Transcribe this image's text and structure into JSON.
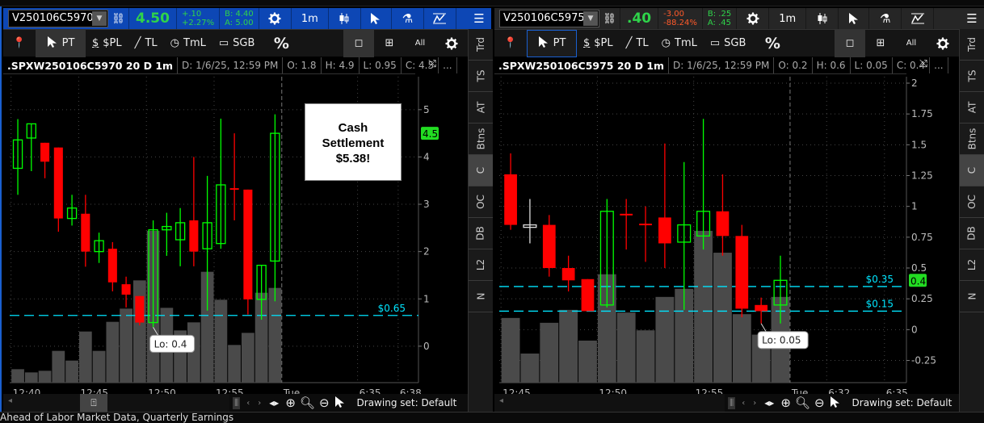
{
  "news_headline": "Ahead of Labor Market Data, Quarterly Earnings",
  "colors": {
    "up": "#00ff00",
    "down": "#ff0000",
    "flat": "#dddddd",
    "volume": "#4a4a4a",
    "price_line": "#00e5ff",
    "active_header": "#0d47b5"
  },
  "panels": [
    {
      "symbol": "V250106C5970",
      "last": "4.50",
      "change": "+.10",
      "change_pct": "+2.27%",
      "change_color": "#2fd34a",
      "bid": "B: 4.40",
      "ask": "A: 5.00",
      "interval": "1m",
      "toolbar": {
        "pt": "PT",
        "pl": "$PL",
        "tl": "TL",
        "tml": "TmL",
        "sgb": "SGB",
        "pct": "%",
        "all": "All"
      },
      "info": {
        "title": ".SPXW250106C5970 20 D 1m",
        "date": "D: 1/6/25, 12:59 PM",
        "open": "O: 1.8",
        "high": "H: 4.9",
        "low": "L: 0.95",
        "close": "C: 4.5",
        "more": "..."
      },
      "tabs": [
        "Trd",
        "TS",
        "AT",
        "Btns",
        "C",
        "OC",
        "DB",
        "L2",
        "N"
      ],
      "selected_tab": "C",
      "drawing_set": "Drawing set: Default",
      "annotation": {
        "line1": "Cash",
        "line2": "Settlement",
        "line3": "$5.38!"
      },
      "chart_data": {
        "type": "candlestick",
        "ylim": [
          -0.77,
          5.56
        ],
        "xlim_bars": [
          -0.6,
          29.6
        ],
        "y_ticks": [
          0,
          1,
          2,
          3,
          4,
          5
        ],
        "y_tick_labels": [
          "0",
          "1",
          "2",
          "3",
          "4",
          "5"
        ],
        "x_ticks": [
          {
            "at": -0.5,
            "label": "12:40"
          },
          {
            "at": 4.5,
            "label": "12:45"
          },
          {
            "at": 9.5,
            "label": "12:50"
          },
          {
            "at": 14.5,
            "label": "12:55"
          },
          {
            "at": 19.5,
            "label": "Tue"
          },
          {
            "at": 25.1,
            "label": "6:35"
          },
          {
            "at": 28.1,
            "label": "6:38"
          }
        ],
        "session_break_at": 19.5,
        "candles": [
          {
            "o": 3.76,
            "h": 4.8,
            "l": 3.2,
            "c": 4.36
          },
          {
            "o": 4.4,
            "h": 4.7,
            "l": 3.7,
            "c": 4.7
          },
          {
            "o": 4.3,
            "h": 4.3,
            "l": 3.55,
            "c": 3.9
          },
          {
            "o": 4.2,
            "h": 4.2,
            "l": 2.42,
            "c": 2.7
          },
          {
            "o": 2.7,
            "h": 3.2,
            "l": 2.55,
            "c": 2.92
          },
          {
            "o": 2.8,
            "h": 3.2,
            "l": 1.68,
            "c": 2.0
          },
          {
            "o": 2.0,
            "h": 2.4,
            "l": 1.76,
            "c": 2.23
          },
          {
            "o": 2.06,
            "h": 2.2,
            "l": 1.16,
            "c": 1.35
          },
          {
            "o": 1.31,
            "h": 1.47,
            "l": 0.82,
            "c": 1.09
          },
          {
            "o": 1.06,
            "h": 1.06,
            "l": 0.44,
            "c": 0.5
          },
          {
            "o": 0.5,
            "h": 2.66,
            "l": 0.4,
            "c": 2.46
          },
          {
            "o": 2.46,
            "h": 2.82,
            "l": 1.91,
            "c": 2.53
          },
          {
            "o": 2.25,
            "h": 2.92,
            "l": 1.69,
            "c": 2.61
          },
          {
            "o": 2.66,
            "h": 4.0,
            "l": 1.69,
            "c": 2.0
          },
          {
            "o": 2.06,
            "h": 3.6,
            "l": 0.75,
            "c": 2.61
          },
          {
            "o": 2.17,
            "h": 4.81,
            "l": 2.06,
            "c": 3.41
          },
          {
            "o": 3.34,
            "h": 4.5,
            "l": 2.66,
            "c": 3.31
          },
          {
            "o": 3.31,
            "h": 3.31,
            "l": 0.67,
            "c": 0.99
          },
          {
            "o": 0.99,
            "h": 1.71,
            "l": 0.56,
            "c": 1.71
          },
          {
            "o": 1.8,
            "h": 4.9,
            "l": 0.95,
            "c": 4.5
          }
        ],
        "volume": [
          50,
          38,
          44,
          118,
          82,
          190,
          118,
          226,
          275,
          380,
          564,
          278,
          194,
          224,
          412,
          308,
          140,
          185,
          334,
          352
        ],
        "price_lines": [
          {
            "value": 0.65,
            "label": "$0.65"
          }
        ],
        "current_price": {
          "value": 4.5,
          "label": "4.5"
        },
        "low_marker": {
          "bar": 10,
          "value": 0.4,
          "label": "Lo: 0.4"
        }
      }
    },
    {
      "symbol": "V250106C5975",
      "last": ".40",
      "change": "-3.00",
      "change_pct": "-88.24%",
      "change_color": "#ff5a2a",
      "bid": "B: .25",
      "ask": "A: .45",
      "interval": "1m",
      "toolbar": {
        "pt": "PT",
        "pl": "$PL",
        "tl": "TL",
        "tml": "TmL",
        "sgb": "SGB",
        "pct": "%",
        "all": "All"
      },
      "info": {
        "title": ".SPXW250106C5975 20 D 1m",
        "date": "D: 1/6/25, 12:59 PM",
        "open": "O: 0.2",
        "high": "H: 0.6",
        "low": "L: 0.05",
        "close": "C: 0.4",
        "more": "..."
      },
      "tabs": [
        "Trd",
        "TS",
        "AT",
        "Btns",
        "C",
        "OC",
        "DB",
        "L2",
        "N"
      ],
      "selected_tab": "C",
      "drawing_set": "Drawing set: Default",
      "chart_data": {
        "type": "candlestick",
        "ylim": [
          -0.43,
          2.0
        ],
        "xlim_bars": [
          -0.59,
          20.54
        ],
        "y_ticks": [
          -0.25,
          0,
          0.25,
          0.5,
          0.75,
          1,
          1.25,
          1.5,
          1.75,
          2
        ],
        "y_tick_labels": [
          "-0.25",
          "0",
          "0.25",
          "0.5",
          "0.75",
          "1",
          "1.25",
          "1.5",
          "1.75",
          "2"
        ],
        "x_ticks": [
          {
            "at": -0.5,
            "label": "12:45"
          },
          {
            "at": 4.5,
            "label": "12:50"
          },
          {
            "at": 9.5,
            "label": "12:55"
          },
          {
            "at": 14.5,
            "label": "Tue"
          },
          {
            "at": 16.4,
            "label": "6:32"
          },
          {
            "at": 19.4,
            "label": "6:35"
          }
        ],
        "session_break_at": 14.5,
        "candles": [
          {
            "o": 1.26,
            "h": 1.43,
            "l": 0.81,
            "c": 0.85
          },
          {
            "o": 0.85,
            "h": 1.06,
            "l": 0.7,
            "c": 0.83,
            "flat": true
          },
          {
            "o": 0.85,
            "h": 0.93,
            "l": 0.43,
            "c": 0.5
          },
          {
            "o": 0.5,
            "h": 0.6,
            "l": 0.31,
            "c": 0.4
          },
          {
            "o": 0.41,
            "h": 0.41,
            "l": 0.15,
            "c": 0.15
          },
          {
            "o": 0.2,
            "h": 1.06,
            "l": 0.18,
            "c": 0.96
          },
          {
            "o": 0.94,
            "h": 1.06,
            "l": 0.65,
            "c": 0.93
          },
          {
            "o": 0.86,
            "h": 1.0,
            "l": 0.55,
            "c": 0.85
          },
          {
            "o": 0.91,
            "h": 1.51,
            "l": 0.5,
            "c": 0.7
          },
          {
            "o": 0.71,
            "h": 1.36,
            "l": 0.16,
            "c": 0.85
          },
          {
            "o": 0.76,
            "h": 1.71,
            "l": 0.65,
            "c": 0.96
          },
          {
            "o": 0.96,
            "h": 1.26,
            "l": 0.6,
            "c": 0.76
          },
          {
            "o": 0.76,
            "h": 0.85,
            "l": 0.1,
            "c": 0.17
          },
          {
            "o": 0.2,
            "h": 0.26,
            "l": 0.05,
            "c": 0.15
          },
          {
            "o": 0.2,
            "h": 0.6,
            "l": 0.05,
            "c": 0.4
          }
        ],
        "volume": [
          240,
          108,
          222,
          270,
          156,
          402,
          260,
          194,
          318,
          348,
          563,
          482,
          254,
          178,
          318
        ],
        "price_lines": [
          {
            "value": 0.35,
            "label": "$0.35"
          },
          {
            "value": 0.15,
            "label": "$0.15"
          }
        ],
        "current_price": {
          "value": 0.4,
          "label": "0.4"
        },
        "low_marker": {
          "bar": 13,
          "value": 0.05,
          "label": "Lo: 0.05"
        }
      }
    }
  ]
}
